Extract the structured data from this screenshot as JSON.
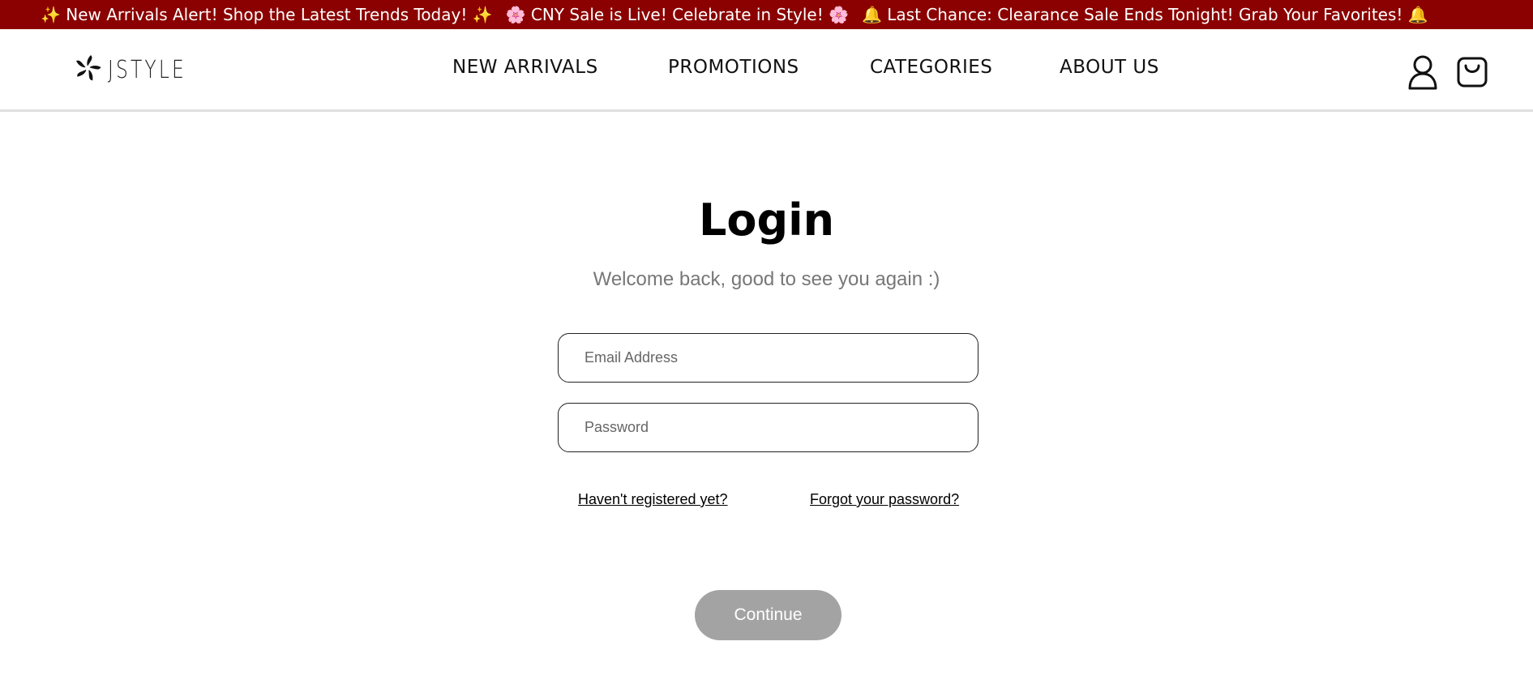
{
  "announcement": {
    "messages": [
      "✨ New Arrivals Alert! Shop the Latest Trends Today! ✨",
      "🌸 CNY Sale is Live! Celebrate in Style! 🌸",
      "🔔 Last Chance: Clearance Sale Ends Tonight! Grab Your Favorites! 🔔"
    ],
    "background_color": "#8b0000"
  },
  "header": {
    "logo_text": "JSTYLE",
    "logo_icon": "flower-icon",
    "nav": [
      "NEW ARRIVALS",
      "PROMOTIONS",
      "CATEGORIES",
      "ABOUT US"
    ],
    "icons": [
      "user-icon",
      "shopping-bag-icon"
    ]
  },
  "login": {
    "title": "Login",
    "subtitle": "Welcome back, good to see you again :)",
    "email_placeholder": "Email Address",
    "password_placeholder": "Password",
    "register_link": "Haven't registered yet?",
    "forgot_link": "Forgot your password?",
    "continue_label": "Continue",
    "continue_color": "#a3a3a3"
  }
}
